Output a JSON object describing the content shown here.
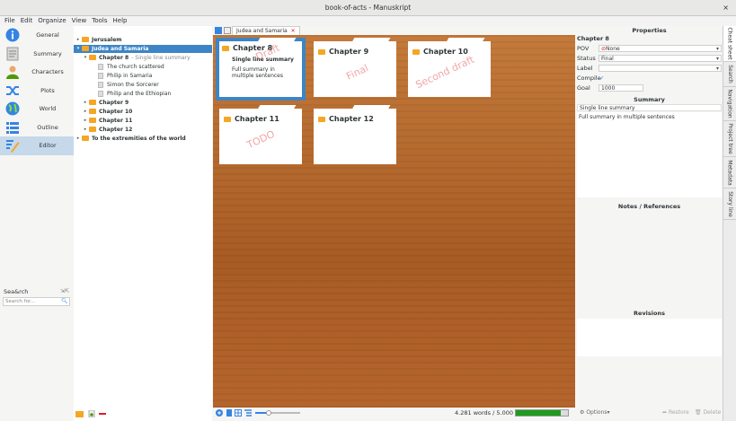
{
  "window": {
    "title": "book-of-acts - Manuskript",
    "close_glyph": "×"
  },
  "menu": [
    "File",
    "Edit",
    "Organize",
    "View",
    "Tools",
    "Help"
  ],
  "nav": [
    {
      "label": "General",
      "icon": "info-icon"
    },
    {
      "label": "Summary",
      "icon": "document-icon"
    },
    {
      "label": "Characters",
      "icon": "person-icon"
    },
    {
      "label": "Plots",
      "icon": "shuffle-icon"
    },
    {
      "label": "World",
      "icon": "globe-icon"
    },
    {
      "label": "Outline",
      "icon": "list-icon"
    },
    {
      "label": "Editor",
      "icon": "pen-icon",
      "active": true
    }
  ],
  "search": {
    "label": "Sea&rch",
    "placeholder": "Search for..."
  },
  "tree": [
    {
      "label": "Jerusalem",
      "type": "folder",
      "indent": 0,
      "collapsed": true
    },
    {
      "label": "Judea and Samaria",
      "type": "folder",
      "indent": 0,
      "expanded": true,
      "selected": true
    },
    {
      "label": "Chapter 8",
      "type": "folder",
      "indent": 1,
      "expanded": true,
      "summary": "- Single line summary"
    },
    {
      "label": "The church scattered",
      "type": "text",
      "indent": 2
    },
    {
      "label": "Philip in Samaria",
      "type": "text",
      "indent": 2
    },
    {
      "label": "Simon the Sorcerer",
      "type": "text",
      "indent": 2
    },
    {
      "label": "Philip and the Ethiopian",
      "type": "text",
      "indent": 2
    },
    {
      "label": "Chapter 9",
      "type": "folder",
      "indent": 1,
      "collapsed": true
    },
    {
      "label": "Chapter 10",
      "type": "folder",
      "indent": 1,
      "collapsed": true
    },
    {
      "label": "Chapter 11",
      "type": "folder",
      "indent": 1,
      "collapsed": true
    },
    {
      "label": "Chapter 12",
      "type": "folder",
      "indent": 1,
      "collapsed": true
    },
    {
      "label": "To the extremities of the world",
      "type": "folder",
      "indent": 0,
      "collapsed": true
    }
  ],
  "tab": {
    "label": "Judea and Samaria"
  },
  "cards": [
    {
      "title": "Chapter 8",
      "line": "Single line summary",
      "summary": "Full summary in multiple sentences",
      "stamp": "Draft",
      "selected": true
    },
    {
      "title": "Chapter 9",
      "line": "",
      "summary": "",
      "stamp": "Final"
    },
    {
      "title": "Chapter 10",
      "line": "",
      "summary": "",
      "stamp": "Second draft"
    },
    {
      "title": "Chapter 11",
      "line": "",
      "summary": "",
      "stamp": "TODO"
    },
    {
      "title": "Chapter 12",
      "line": "",
      "summary": "",
      "stamp": ""
    }
  ],
  "status": {
    "words": "4.281 words / 5.000",
    "progress": 0.856
  },
  "properties": {
    "heading": "Properties",
    "item": "Chapter 8",
    "pov_label": "POV",
    "pov_value": "None",
    "status_label": "Status",
    "status_value": "Final",
    "label_label": "Label",
    "label_value": "",
    "compile_label": "Compile",
    "compile_checked": true,
    "goal_label": "Goal",
    "goal_value": "1000",
    "summary_heading": "Summary",
    "summary_line": "Single line summary",
    "summary_full": "Full summary in multiple sentences",
    "notes_heading": "Notes / References",
    "revisions_heading": "Revisions",
    "options": "Options",
    "restore": "Restore",
    "delete": "Delete"
  },
  "vtabs": [
    "Cheat sheet",
    "Search",
    "Navigation",
    "Project tree",
    "Metadata",
    "Story line"
  ]
}
